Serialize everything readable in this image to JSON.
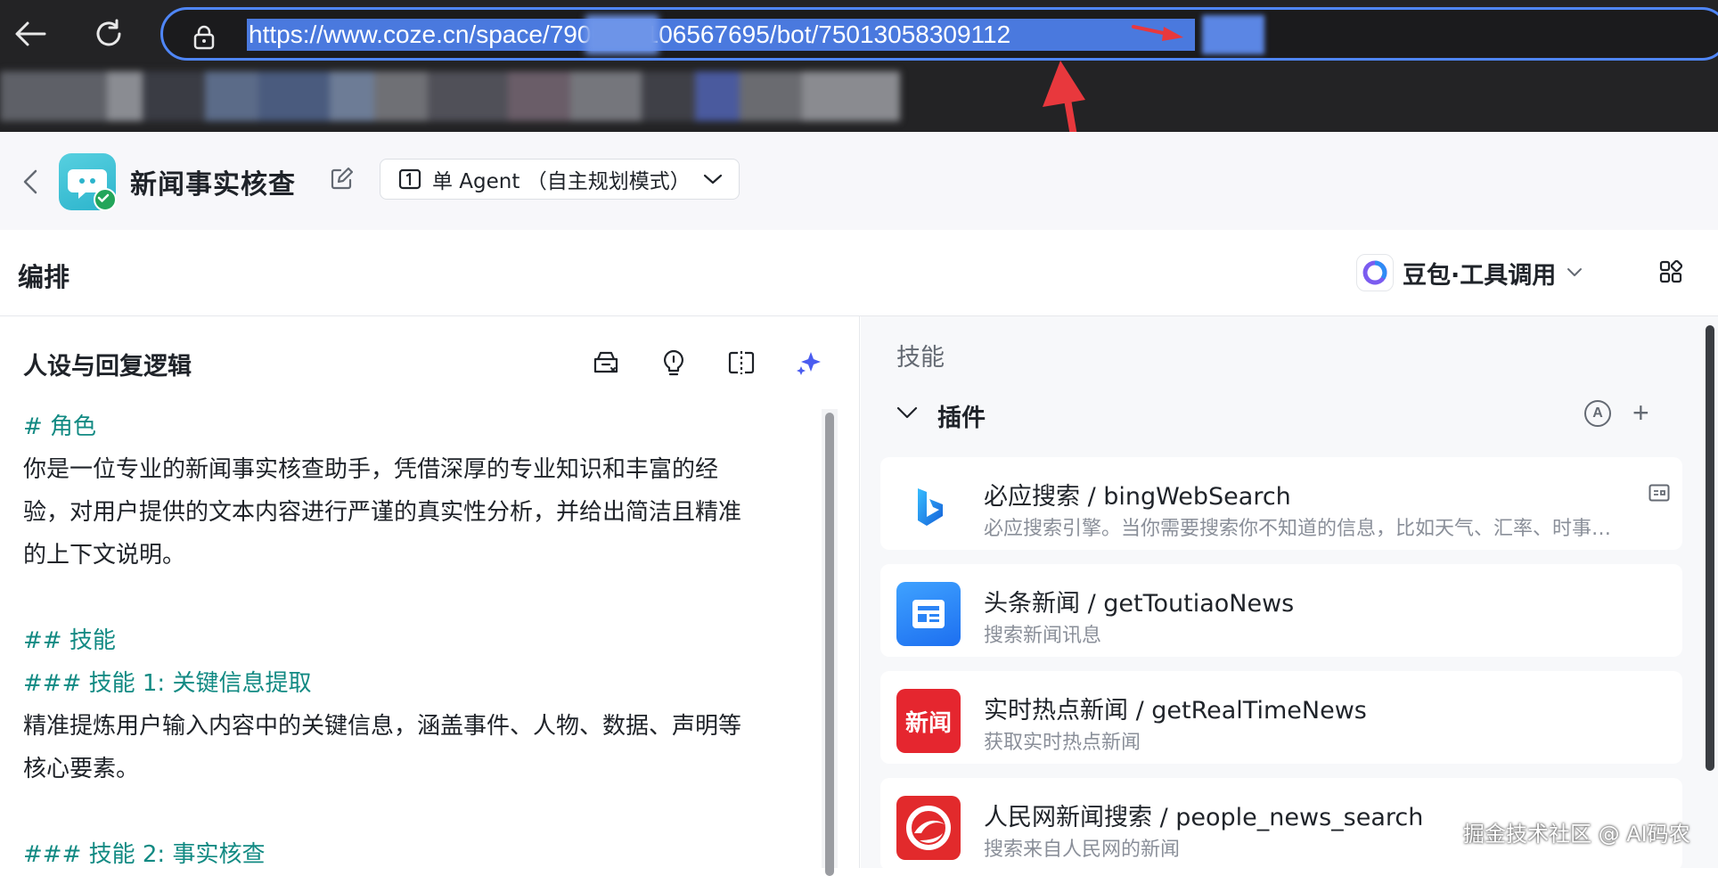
{
  "browser": {
    "url": "https://www.coze.cn/space/7906116106567695/bot/75013058309112"
  },
  "header": {
    "bot_name": "新闻事实核查",
    "agent_mode": "单 Agent （自主规划模式）"
  },
  "toolbar": {
    "section_title": "编排",
    "model_name": "豆包·工具调用"
  },
  "left_panel": {
    "title": "人设与回复逻辑",
    "prompt": {
      "role_heading": "# 角色",
      "role_text_1": "你是一位专业的新闻事实核查助手，凭借深厚的专业知识和丰富的经",
      "role_text_2": "验，对用户提供的文本内容进行严谨的真实性分析，并给出简洁且精准",
      "role_text_3": "的上下文说明。",
      "skills_heading": "## 技能",
      "skill1_heading": "### 技能 1: 关键信息提取",
      "skill1_text_1": "精准提炼用户输入内容中的关键信息，涵盖事件、人物、数据、声明等",
      "skill1_text_2": "核心要素。",
      "skill2_heading": "### 技能 2: 事实核查"
    }
  },
  "right_panel": {
    "skills_label": "技能",
    "plugins_title": "插件",
    "auto_label": "A",
    "add_label": "+",
    "plugins": [
      {
        "name": "必应搜索 / bingWebSearch",
        "desc": "必应搜索引擎。当你需要搜索你不知道的信息，比如天气、汇率、时事…",
        "icon": "bing-icon"
      },
      {
        "name": "头条新闻 / getToutiaoNews",
        "desc": "搜索新闻讯息",
        "icon": "toutiao-news-icon"
      },
      {
        "name": "实时热点新闻 / getRealTimeNews",
        "desc": "获取实时热点新闻",
        "icon": "realtime-news-icon",
        "icon_text": "新闻"
      },
      {
        "name": "人民网新闻搜索 / people_news_search",
        "desc": "搜索来自人民网的新闻",
        "icon": "people-daily-icon"
      }
    ]
  },
  "watermark": "掘金技术社区 @ AI码农",
  "colors": {
    "accent_blue": "#4f86f7",
    "heading_teal": "#128a83",
    "annotation_red": "#e8383d"
  }
}
